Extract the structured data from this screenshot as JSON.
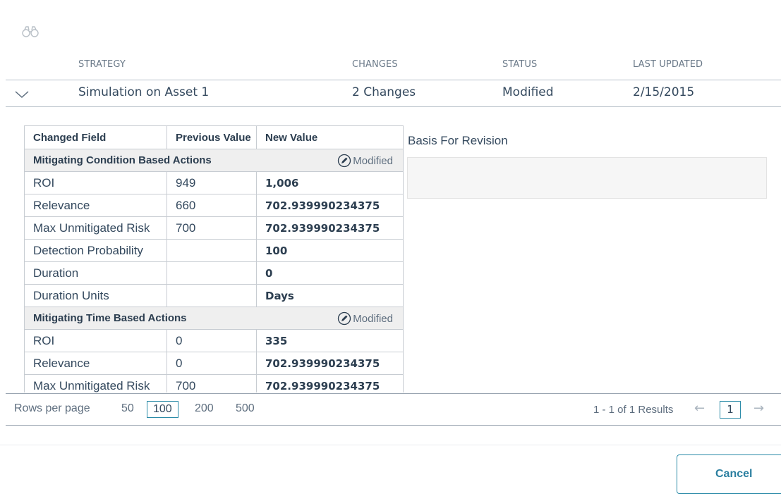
{
  "grid": {
    "headers": [
      "STRATEGY",
      "CHANGES",
      "STATUS",
      "LAST UPDATED"
    ],
    "row": {
      "strategy": "Simulation on Asset 1",
      "changes": "2 Changes",
      "status": "Modified",
      "last_updated": "2/15/2015"
    }
  },
  "details": {
    "columns": [
      "Changed Field",
      "Previous Value",
      "New Value"
    ],
    "groups": [
      {
        "name": "Mitigating Condition Based Actions",
        "badge": "Modified",
        "rows": [
          {
            "field": "ROI",
            "prev": "949",
            "new": "1,006"
          },
          {
            "field": "Relevance",
            "prev": "660",
            "new": "702.939990234375"
          },
          {
            "field": "Max Unmitigated Risk",
            "prev": "700",
            "new": "702.939990234375"
          },
          {
            "field": "Detection Probability",
            "prev": "",
            "new": "100"
          },
          {
            "field": "Duration",
            "prev": "",
            "new": "0"
          },
          {
            "field": "Duration Units",
            "prev": "",
            "new": "Days"
          }
        ]
      },
      {
        "name": "Mitigating Time Based Actions",
        "badge": "Modified",
        "rows": [
          {
            "field": "ROI",
            "prev": "0",
            "new": "335"
          },
          {
            "field": "Relevance",
            "prev": "0",
            "new": "702.939990234375"
          },
          {
            "field": "Max Unmitigated Risk",
            "prev": "700",
            "new": "702.939990234375"
          }
        ]
      }
    ]
  },
  "basis": {
    "label": "Basis For Revision",
    "value": ""
  },
  "pager": {
    "rows_per_page_label": "Rows per page",
    "options": [
      "50",
      "100",
      "200",
      "500"
    ],
    "selected": "100",
    "results": "1 - 1 of 1 Results",
    "current_page": "1",
    "prev_arrow": "←",
    "next_arrow": "→"
  },
  "actions": {
    "cancel_label": "Cancel"
  },
  "icons": {
    "search": "binoculars-icon",
    "expand": "chevron-down-icon",
    "edit": "pencil-circle-icon"
  },
  "colors": {
    "accent": "#2b8ba8",
    "text": "#34495e",
    "group_bg": "#efefef"
  }
}
